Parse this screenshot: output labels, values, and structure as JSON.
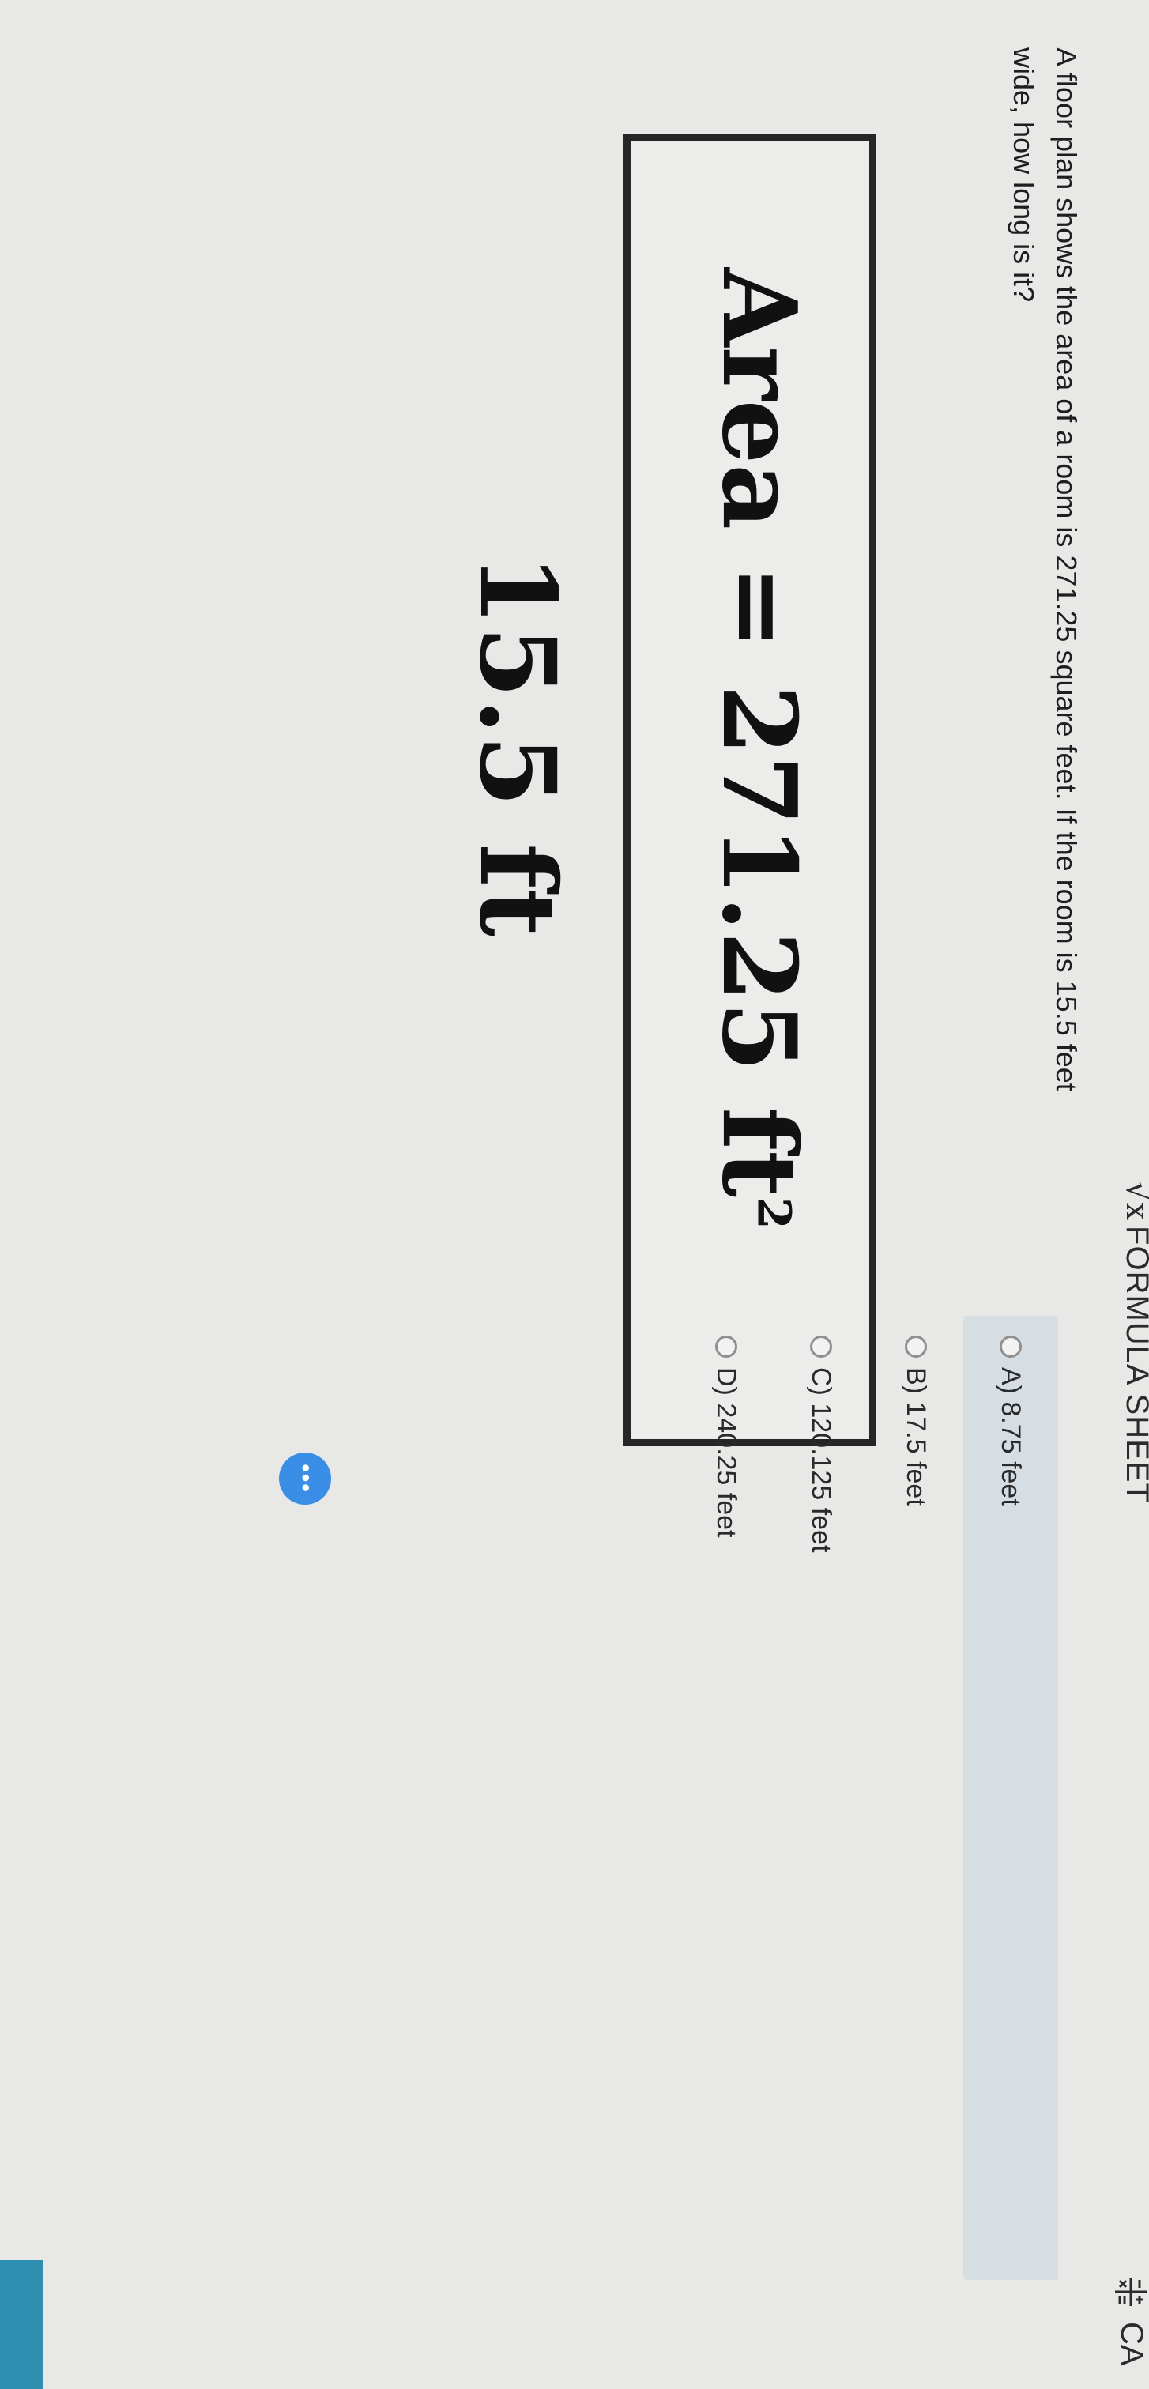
{
  "toolbar": {
    "formula_icon": "√x",
    "formula_label": "FORMULA SHEET",
    "calculator_icon": "calculator-icon",
    "calculator_label": "CA"
  },
  "question": {
    "text": "A floor plan shows the area of a room is 271.25 square feet. If the room is 15.5 feet wide, how long is it?"
  },
  "diagram": {
    "area_text": "Area = 271.25 ft",
    "area_exponent": "2",
    "width_text": "15.5 ft"
  },
  "choices": [
    {
      "letter": "A)",
      "label": "8.75 feet"
    },
    {
      "letter": "B)",
      "label": "17.5 feet"
    },
    {
      "letter": "C)",
      "label": "120.125 feet"
    },
    {
      "letter": "D)",
      "label": "240.25 feet"
    }
  ],
  "more_button": {
    "label": "•••"
  },
  "colors": {
    "selected_choice_bg": "#d6dde3",
    "more_button_bg": "#3b8ee6",
    "accent": "#2f8fb0"
  }
}
